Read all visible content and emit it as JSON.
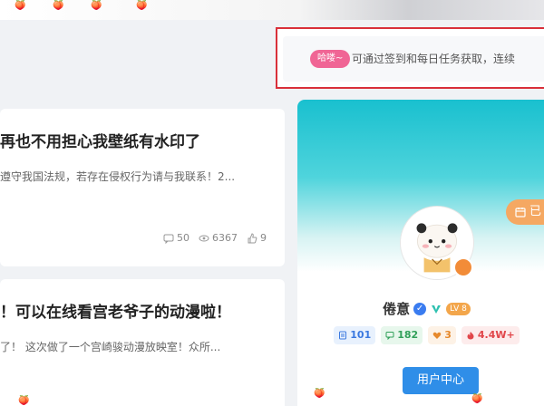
{
  "notice": {
    "badge": "哈喽~",
    "text": "可通过签到和每日任务获取，连续"
  },
  "posts": [
    {
      "title": "再也不用担心我壁纸有水印了",
      "excerpt": "遵守我国法规，若存在侵权行为请与我联系！2...",
      "comments": "50",
      "views": "6367",
      "likes": "9"
    },
    {
      "title": "！可以在线看宫老爷子的动漫啦！",
      "excerpt": "了！ 这次做了一个宫崎骏动漫放映室！众所..."
    }
  ],
  "profile": {
    "signin_label": "已",
    "username": "倦意",
    "level": "LV 8",
    "counts": {
      "posts": "101",
      "comments": "182",
      "likes": "3",
      "views": "4.4W+"
    },
    "center_button": "用户中心"
  },
  "colors": {
    "notice_border": "#d9303a",
    "notice_badge": "#f06595",
    "cover_top": "#19c0cf",
    "signin_bg": "#f5a862",
    "center_button_bg": "#2f8ee8"
  }
}
